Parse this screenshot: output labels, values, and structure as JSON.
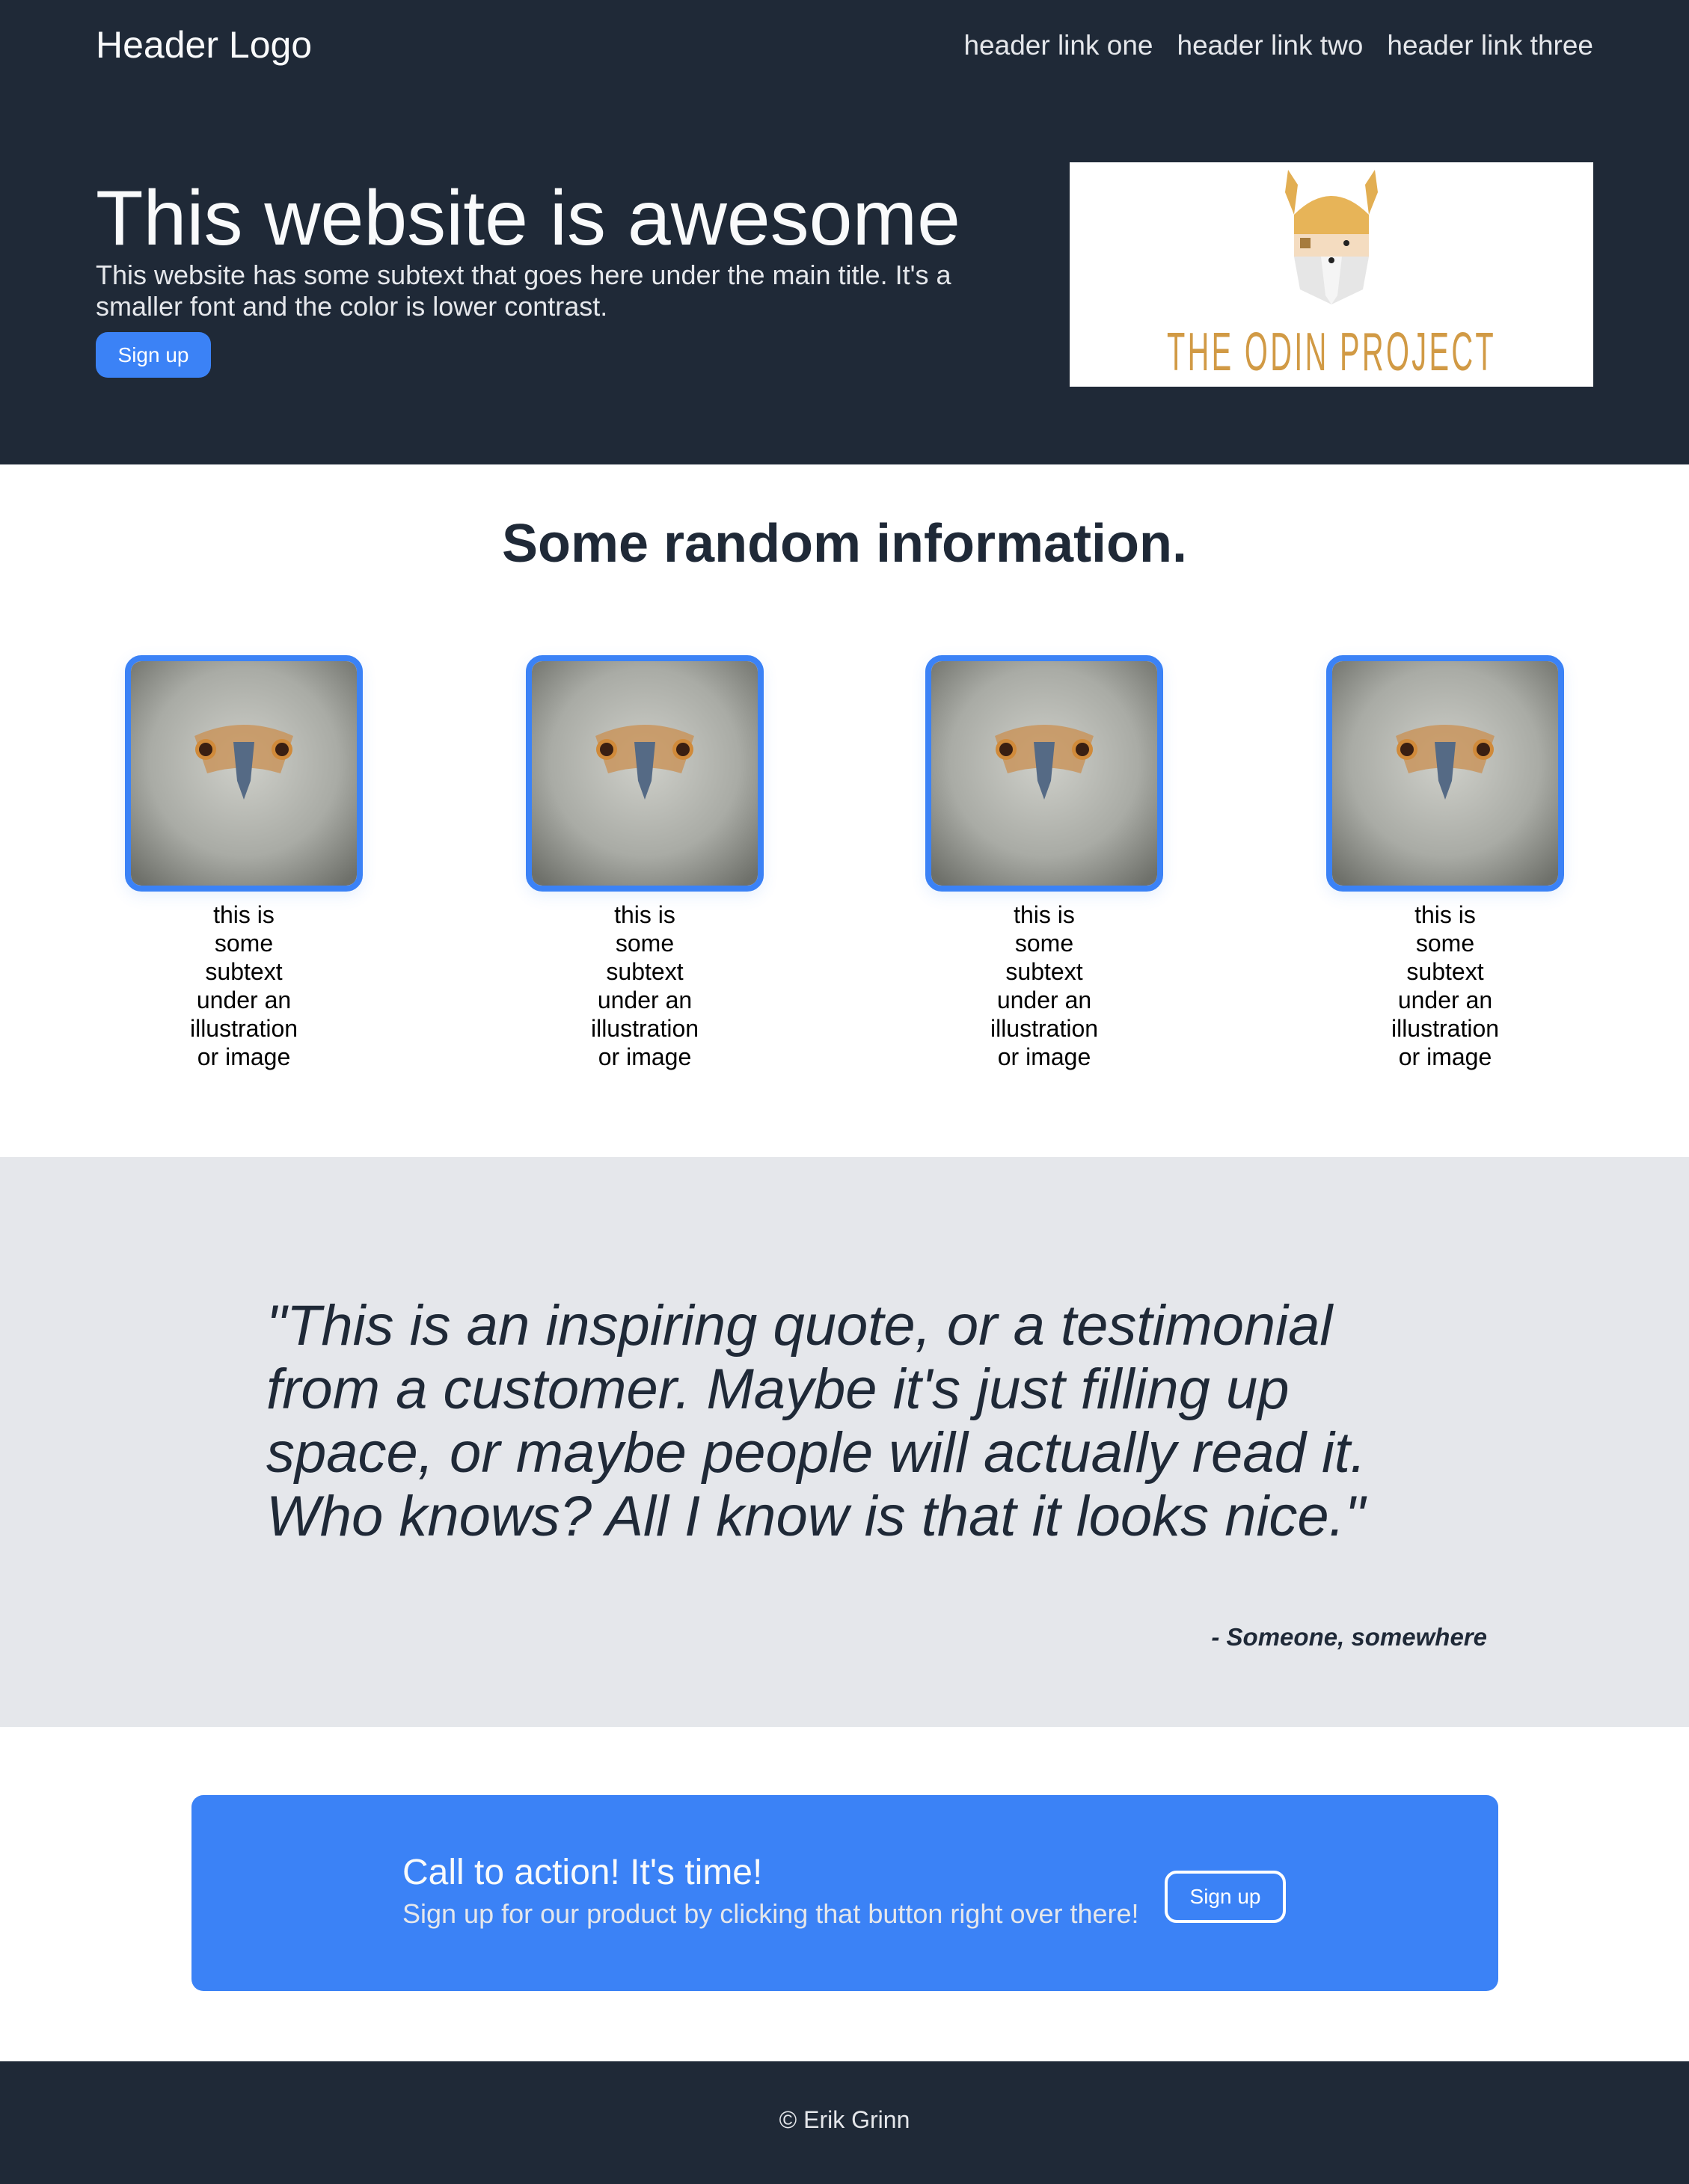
{
  "header": {
    "logo": "Header Logo",
    "links": [
      "header link one",
      "header link two",
      "header link three"
    ]
  },
  "hero": {
    "title": "This website is awesome",
    "subtext": "This website has some subtext that goes here under the main title. It's a smaller font and the color is lower contrast.",
    "button_label": "Sign up",
    "image": {
      "alt": "The Odin Project logo",
      "wordmark": "THE ODIN PROJECT"
    }
  },
  "info": {
    "title": "Some random information.",
    "cards": [
      {
        "image": "eagle-photo",
        "caption": "this is some subtext under an illustration or image"
      },
      {
        "image": "eagle-photo",
        "caption": "this is some subtext under an illustration or image"
      },
      {
        "image": "eagle-photo",
        "caption": "this is some subtext under an illustration or image"
      },
      {
        "image": "eagle-photo",
        "caption": "this is some subtext under an illustration or image"
      }
    ]
  },
  "quote": {
    "text": "\"This is an inspiring quote, or a testimonial from a customer. Maybe it's just filling up space, or maybe people will actually read it. Who knows? All I know is that it looks nice.\"",
    "attribution": "- Someone, somewhere"
  },
  "cta": {
    "title": "Call to action! It's time!",
    "subtext": "Sign up for our product by clicking that button right over there!",
    "button_label": "Sign up"
  },
  "footer": {
    "text": "© Erik Grinn"
  },
  "colors": {
    "dark": "#1f2937",
    "accent": "#3b82f6",
    "light_gray": "#e5e7eb",
    "odin_gold": "#d19a45"
  }
}
